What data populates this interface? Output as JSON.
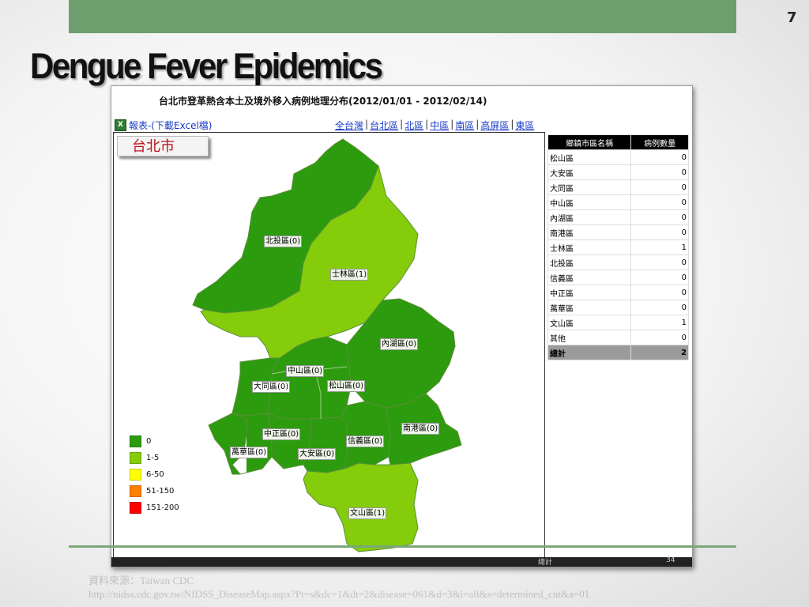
{
  "slide": {
    "number": "7",
    "title": "Dengue Fever Epidemics",
    "source_label": "資料來源：Taiwan CDC",
    "source_url": "http://nidss.cdc.gov.tw/NIDSS_DiseaseMap.aspx?Pt=s&dc=1&dt=2&disease=061&d=3&i=all&s=determined_cnt&a=01"
  },
  "colors": {
    "topbar": "#6e9e6e",
    "level_0": "#2c9b0e",
    "level_1_5": "#85cc0a",
    "level_6_50": "#ffff00",
    "level_51_150": "#ff7f00",
    "level_151_200": "#ff0000"
  },
  "screenshot": {
    "header": "台北市登革熱含本土及境外移入病例地理分布(2012/01/01 - 2012/02/14)",
    "excel_link": "報表-(下載Excel檔)",
    "region_links": [
      "全台灣",
      "台北區",
      "北區",
      "中區",
      "南區",
      "高屏區",
      "東區"
    ],
    "city_name": "台北市",
    "map_labels": [
      "北投區(0)",
      "士林區(1)",
      "內湖區(0)",
      "中山區(0)",
      "大同區(0)",
      "松山區(0)",
      "中正區(0)",
      "萬華區(0)",
      "大安區(0)",
      "信義區(0)",
      "南港區(0)",
      "文山區(1)"
    ],
    "legend": [
      "0",
      "1-5",
      "6-50",
      "51-150",
      "151-200"
    ],
    "table": {
      "headers": [
        "鄉鎮市區名稱",
        "病例數量"
      ],
      "rows": [
        [
          "松山區",
          "0"
        ],
        [
          "大安區",
          "0"
        ],
        [
          "大同區",
          "0"
        ],
        [
          "中山區",
          "0"
        ],
        [
          "內湖區",
          "0"
        ],
        [
          "南港區",
          "0"
        ],
        [
          "士林區",
          "1"
        ],
        [
          "北投區",
          "0"
        ],
        [
          "信義區",
          "0"
        ],
        [
          "中正區",
          "0"
        ],
        [
          "萬華區",
          "0"
        ],
        [
          "文山區",
          "1"
        ],
        [
          "其他",
          "0"
        ]
      ],
      "total_label": "總計",
      "total_value": "2"
    },
    "bottom_strip_left": "總計",
    "bottom_strip_right": "34"
  }
}
